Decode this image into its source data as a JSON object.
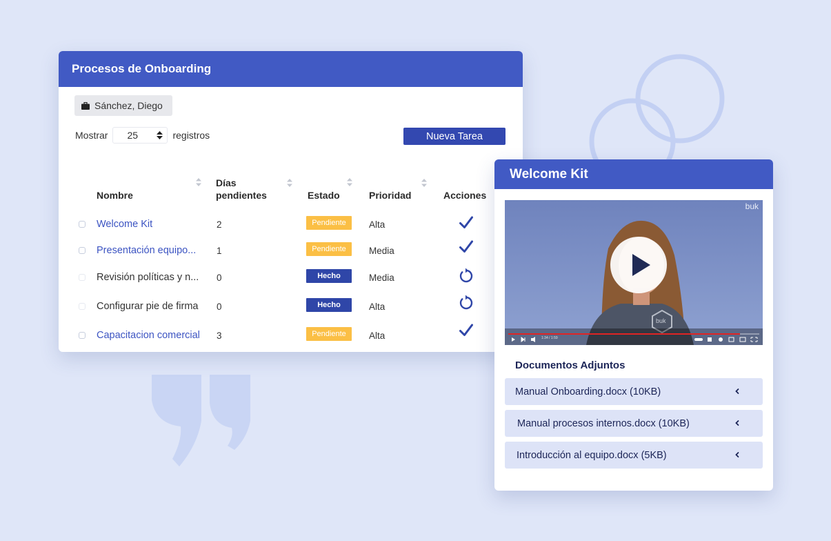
{
  "colors": {
    "background": "#dfe6f8",
    "header": "#415ac4",
    "button": "#3348b0",
    "link": "#3c54c2",
    "pending": "#fbbf45",
    "done": "#2f46a8",
    "doc_bg": "#dde3f7"
  },
  "main": {
    "title": "Procesos de Onboarding",
    "user_chip": {
      "icon": "briefcase-icon",
      "label": "Sánchez, Diego"
    },
    "show": {
      "prefix": "Mostrar",
      "value": "25",
      "suffix": "registros"
    },
    "new_task_label": "Nueva Tarea",
    "columns": {
      "nombre": "Nombre",
      "dias_line1": "Días",
      "dias_line2": "pendientes",
      "estado": "Estado",
      "prioridad": "Prioridad",
      "acciones": "Acciones"
    },
    "rows": [
      {
        "name": "Welcome Kit",
        "dias": "2",
        "estado": "Pendiente",
        "prioridad": "Alta",
        "action": "check-icon"
      },
      {
        "name": "Presentación equipo...",
        "dias": "1",
        "estado": "Pendiente",
        "prioridad": "Media",
        "action": "check-icon"
      },
      {
        "name": "Revisión políticas y n...",
        "dias": "0",
        "estado": "Hecho",
        "prioridad": "Media",
        "action": "redo-icon"
      },
      {
        "name": "Configurar pie de firma",
        "dias": "0",
        "estado": "Hecho",
        "prioridad": "Alta",
        "action": "redo-icon"
      },
      {
        "name": "Capacitacion comercial",
        "dias": "3",
        "estado": "Pendiente",
        "prioridad": "Alta",
        "action": "check-icon"
      }
    ]
  },
  "side": {
    "title": "Welcome Kit",
    "video": {
      "watermark": "buk",
      "time": "1:34 / 1:59",
      "shirt_logo": "buk"
    },
    "docs_title": "Documentos Adjuntos",
    "docs": [
      {
        "label": "Manual Onboarding.docx (10KB)"
      },
      {
        "label": "Manual procesos internos.docx (10KB)"
      },
      {
        "label": "Introducción al equipo.docx (5KB)"
      }
    ]
  }
}
